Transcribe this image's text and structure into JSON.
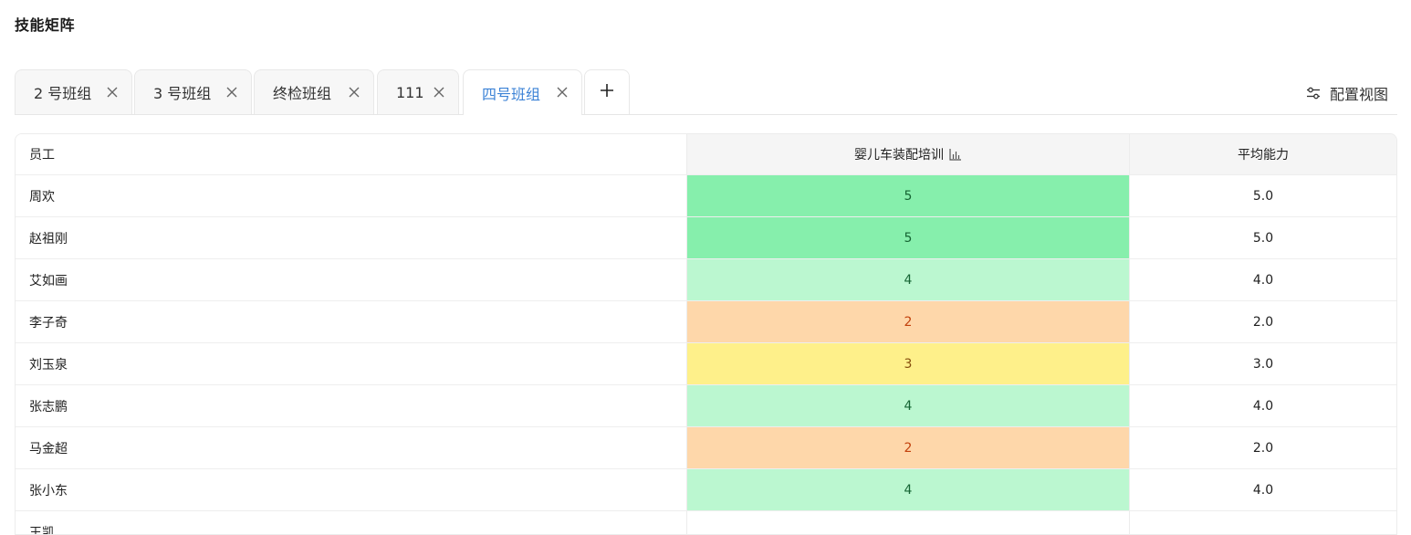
{
  "page": {
    "title": "技能矩阵"
  },
  "tabs": [
    {
      "label": "2 号班组",
      "active": false
    },
    {
      "label": "3 号班组",
      "active": false
    },
    {
      "label": "终检班组",
      "active": false
    },
    {
      "label": "111",
      "active": false
    },
    {
      "label": "四号班组",
      "active": true
    }
  ],
  "toolbar": {
    "config_label": "配置视图"
  },
  "table": {
    "headers": {
      "employee": "员工",
      "skill": "婴儿车装配培训",
      "average": "平均能力"
    },
    "rows": [
      {
        "name": "周欢",
        "skill": "5",
        "avg": "5.0",
        "level": 5
      },
      {
        "name": "赵祖刚",
        "skill": "5",
        "avg": "5.0",
        "level": 5
      },
      {
        "name": "艾如画",
        "skill": "4",
        "avg": "4.0",
        "level": 4
      },
      {
        "name": "李子奇",
        "skill": "2",
        "avg": "2.0",
        "level": 2
      },
      {
        "name": "刘玉泉",
        "skill": "3",
        "avg": "3.0",
        "level": 3
      },
      {
        "name": "张志鹏",
        "skill": "4",
        "avg": "4.0",
        "level": 4
      },
      {
        "name": "马金超",
        "skill": "2",
        "avg": "2.0",
        "level": 2
      },
      {
        "name": "张小东",
        "skill": "4",
        "avg": "4.0",
        "level": 4
      },
      {
        "name": "王凯",
        "skill": "",
        "avg": "",
        "level": 0
      }
    ]
  },
  "colors": {
    "accent": "#3b82d6",
    "level5": "#86efac",
    "level4": "#bbf7d0",
    "level3": "#fef08a",
    "level2": "#fed7aa"
  }
}
